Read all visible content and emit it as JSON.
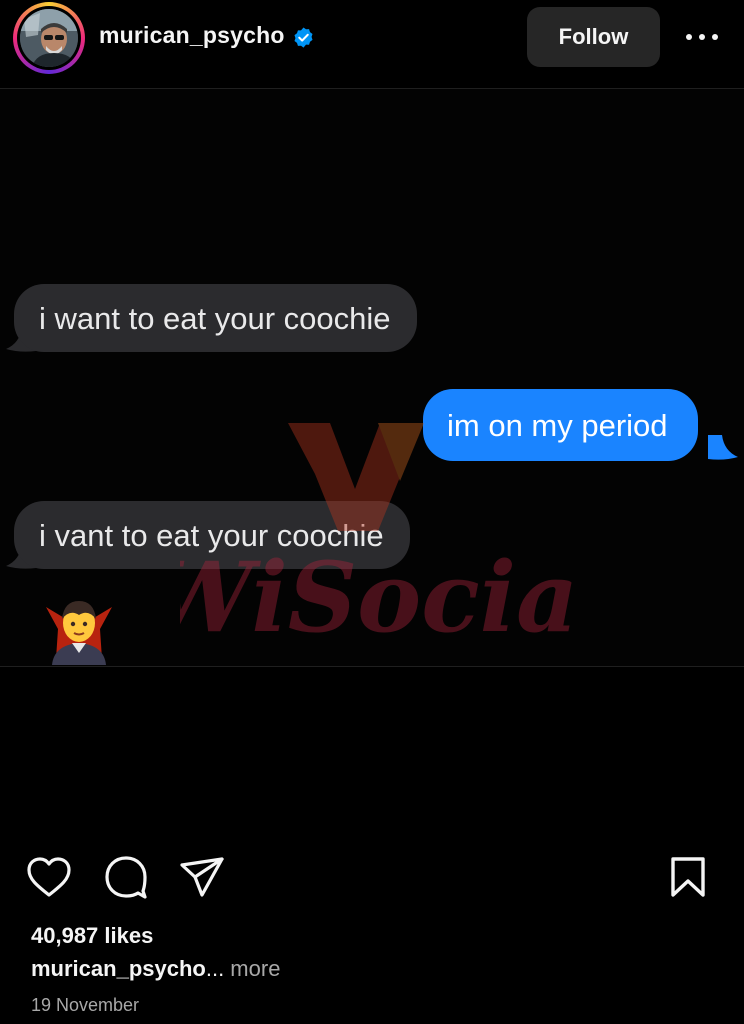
{
  "header": {
    "username": "murican_psycho",
    "verified": true,
    "follow_label": "Follow",
    "avatar_icon": "profile-photo",
    "more_icon": "ellipsis-icon"
  },
  "post": {
    "messages": [
      {
        "side": "left",
        "text": "i want to eat your coochie",
        "color": "#2b2b2e"
      },
      {
        "side": "right",
        "text": "im on my period",
        "color": "#1a84ff"
      },
      {
        "side": "left",
        "text": "i vant to eat your coochie",
        "color": "#2b2b2e"
      }
    ],
    "emoji": "vampire",
    "watermark": "WiSocial"
  },
  "actions": {
    "icons": [
      "heart-icon",
      "comment-icon",
      "share-icon",
      "bookmark-icon"
    ]
  },
  "likes_text": "40,987 likes",
  "caption": {
    "username": "murican_psycho",
    "ellipsis": "...",
    "more_label": " more"
  },
  "date": "19 November",
  "colors": {
    "background": "#000000",
    "follow_button": "#262626",
    "verified_badge": "#0095f6",
    "imessage_blue": "#1a84ff",
    "imessage_gray": "#2b2b2e",
    "secondary_text": "#a8a8a8"
  }
}
